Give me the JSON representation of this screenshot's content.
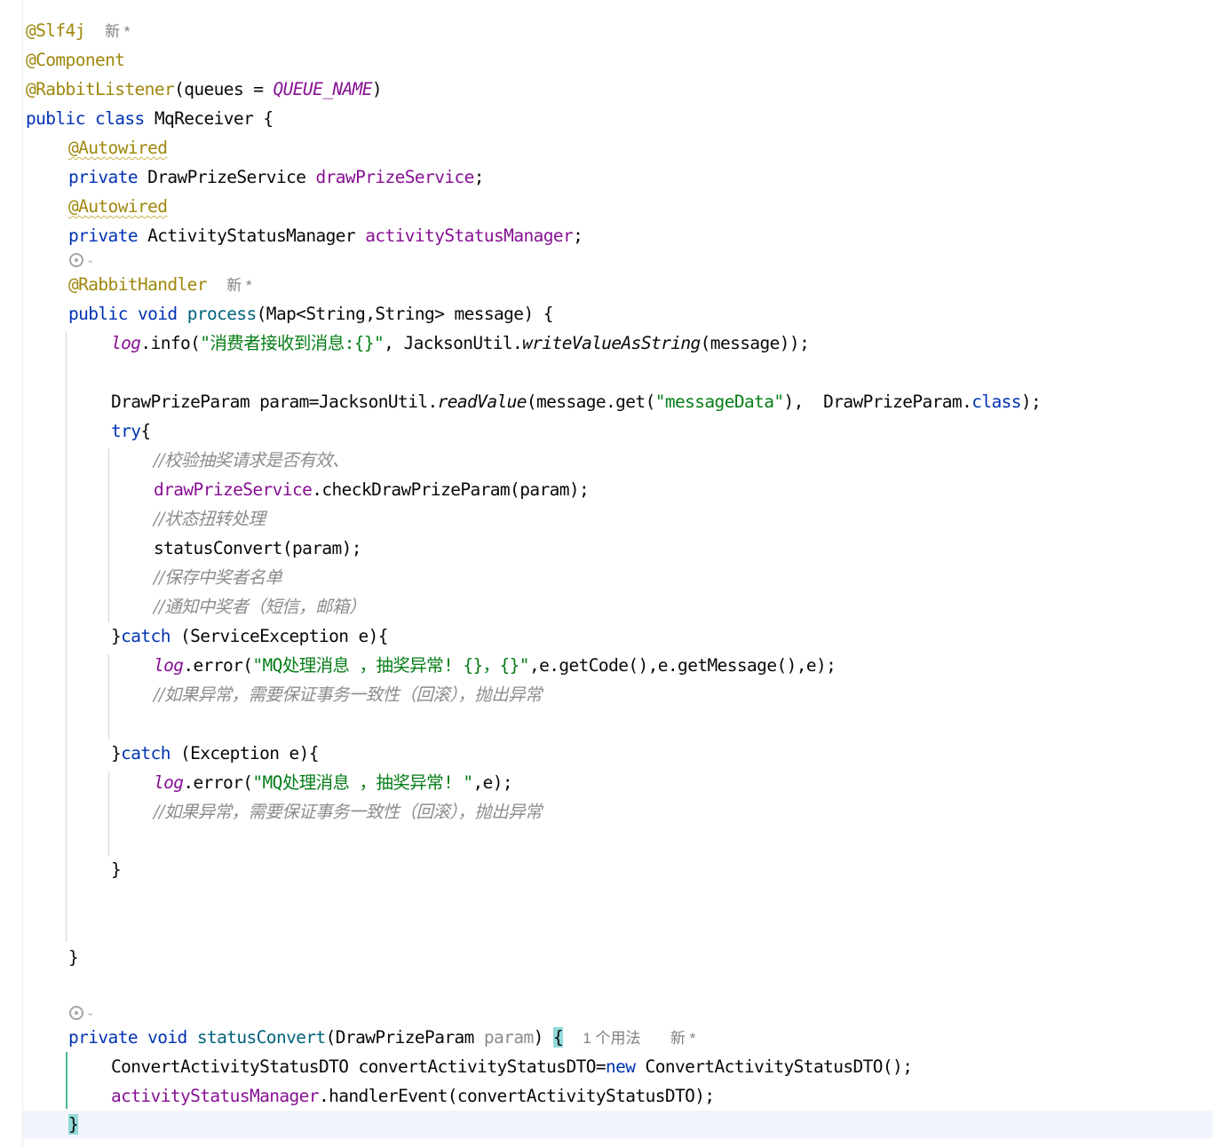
{
  "lines": {
    "l1": {
      "a": "@Slf4j",
      "hint": "新 *"
    },
    "l2": {
      "a": "@Component"
    },
    "l3": {
      "a": "@RabbitListener",
      "b": "(queues = ",
      "c": "QUEUE_NAME",
      "d": ")"
    },
    "l4": {
      "k1": "public",
      "k2": "class",
      "t": " MqReceiver {"
    },
    "l5": {
      "a": "@Autowired"
    },
    "l6": {
      "k": "private",
      "t": " DrawPrizeService ",
      "f": "drawPrizeService",
      "e": ";"
    },
    "l7": {
      "a": "@Autowired"
    },
    "l8": {
      "k": "private",
      "t": " ActivityStatusManager ",
      "f": "activityStatusManager",
      "e": ";"
    },
    "l9": {
      "a": "@RabbitHandler",
      "hint": "新 *"
    },
    "l10": {
      "k1": "public",
      "k2": "void",
      "fn": "process",
      "t": "(Map<String,String> message) {"
    },
    "l11": {
      "log": "log",
      "a": ".info(",
      "s": "\"消费者接收到消息:{}\"",
      "b": ", JacksonUtil.",
      "st": "writeValueAsString",
      "c": "(message));"
    },
    "l12": {
      "a": "DrawPrizeParam param=JacksonUtil.",
      "st": "readValue",
      "b": "(message.get(",
      "s": "\"messageData\"",
      "c": "),  DrawPrizeParam.",
      "k": "class",
      "d": ");"
    },
    "l13": {
      "k": "try",
      "t": "{"
    },
    "l14": {
      "c": "//校验抽奖请求是否有效、"
    },
    "l15": {
      "f": "drawPrizeService",
      "t": ".checkDrawPrizeParam(param);"
    },
    "l16": {
      "c": "//状态扭转处理"
    },
    "l17": {
      "t": "statusConvert(param);"
    },
    "l18": {
      "c": "//保存中奖者名单"
    },
    "l19": {
      "c": "//通知中奖者（短信，邮箱）"
    },
    "l20": {
      "a": "}",
      "k": "catch",
      "t": " (ServiceException e){"
    },
    "l21": {
      "log": "log",
      "a": ".error(",
      "s": "\"MQ处理消息 ，抽奖异常! {}，{}\"",
      "t": ",e.getCode(),e.getMessage(),e);"
    },
    "l22": {
      "c": "//如果异常，需要保证事务一致性（回滚），抛出异常"
    },
    "l23": {
      "a": "}",
      "k": "catch",
      "t": " (Exception e){"
    },
    "l24": {
      "log": "log",
      "a": ".error(",
      "s": "\"MQ处理消息 ，抽奖异常! \"",
      "t": ",e);"
    },
    "l25": {
      "c": "//如果异常，需要保证事务一致性（回滚），抛出异常"
    },
    "l26": {
      "t": "}"
    },
    "l27": {
      "t": "}"
    },
    "l28": {
      "k1": "private",
      "k2": "void",
      "fn": "statusConvert",
      "a": "(DrawPrizeParam ",
      "p": "param",
      "b": ") ",
      "br": "{",
      "hint1": "1 个用法",
      "hint2": "新 *"
    },
    "l29": {
      "t": "ConvertActivityStatusDTO convertActivityStatusDTO=",
      "k": "new",
      "b": " ConvertActivityStatusDTO();"
    },
    "l30": {
      "f": "activityStatusManager",
      "t": ".handlerEvent(convertActivityStatusDTO);"
    },
    "l31": {
      "br": "}"
    }
  },
  "icons": {
    "gutter": "run-gutter-icon",
    "chevron": "chevron-down-icon"
  }
}
